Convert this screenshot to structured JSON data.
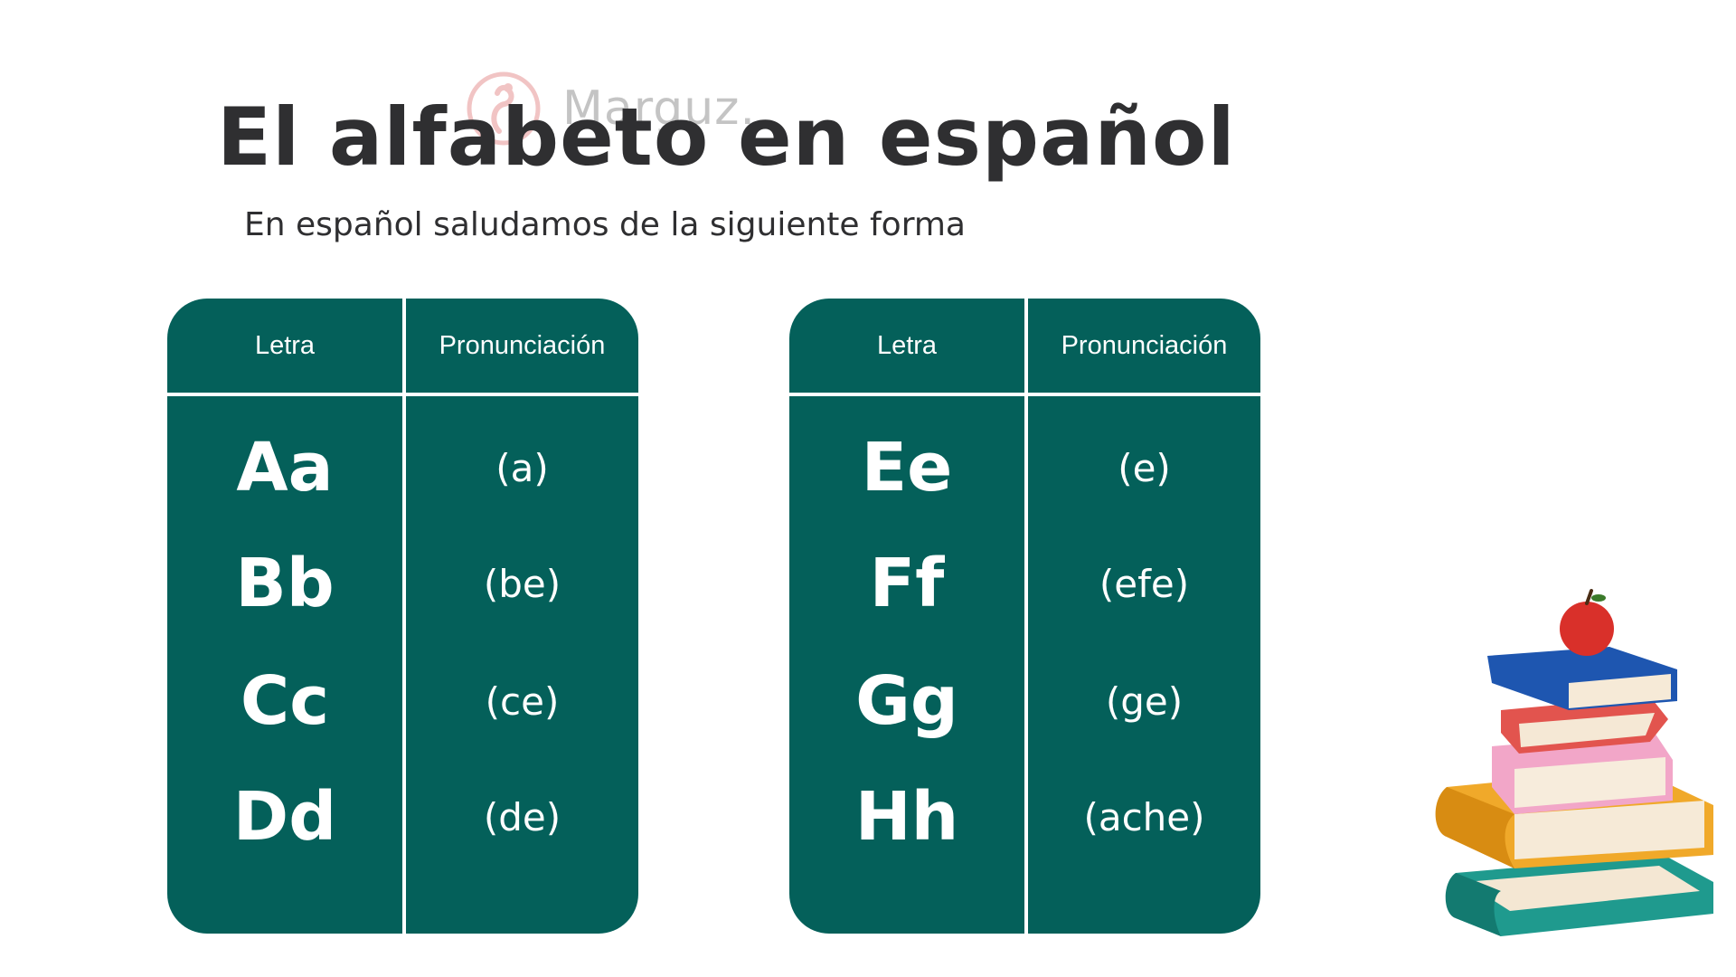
{
  "title": "El alfabeto en español",
  "subtitle": "En español saludamos de la siguiente forma",
  "watermark": {
    "text": "Marguz."
  },
  "colors": {
    "card": "#04605a",
    "title": "#2f2f31",
    "divider": "#ffffff"
  },
  "tables": [
    {
      "header": {
        "letter": "Letra",
        "pronunciation": "Pronunciación"
      },
      "rows": [
        {
          "letter": "Aa",
          "pronunciation": "(a)"
        },
        {
          "letter": "Bb",
          "pronunciation": "(be)"
        },
        {
          "letter": "Cc",
          "pronunciation": "(ce)"
        },
        {
          "letter": "Dd",
          "pronunciation": "(de)"
        }
      ]
    },
    {
      "header": {
        "letter": "Letra",
        "pronunciation": "Pronunciación"
      },
      "rows": [
        {
          "letter": "Ee",
          "pronunciation": "(e)"
        },
        {
          "letter": "Ff",
          "pronunciation": "(efe)"
        },
        {
          "letter": "Gg",
          "pronunciation": "(ge)"
        },
        {
          "letter": "Hh",
          "pronunciation": "(ache)"
        }
      ]
    }
  ],
  "illustration": {
    "icon": "book-stack-with-apple-icon"
  }
}
